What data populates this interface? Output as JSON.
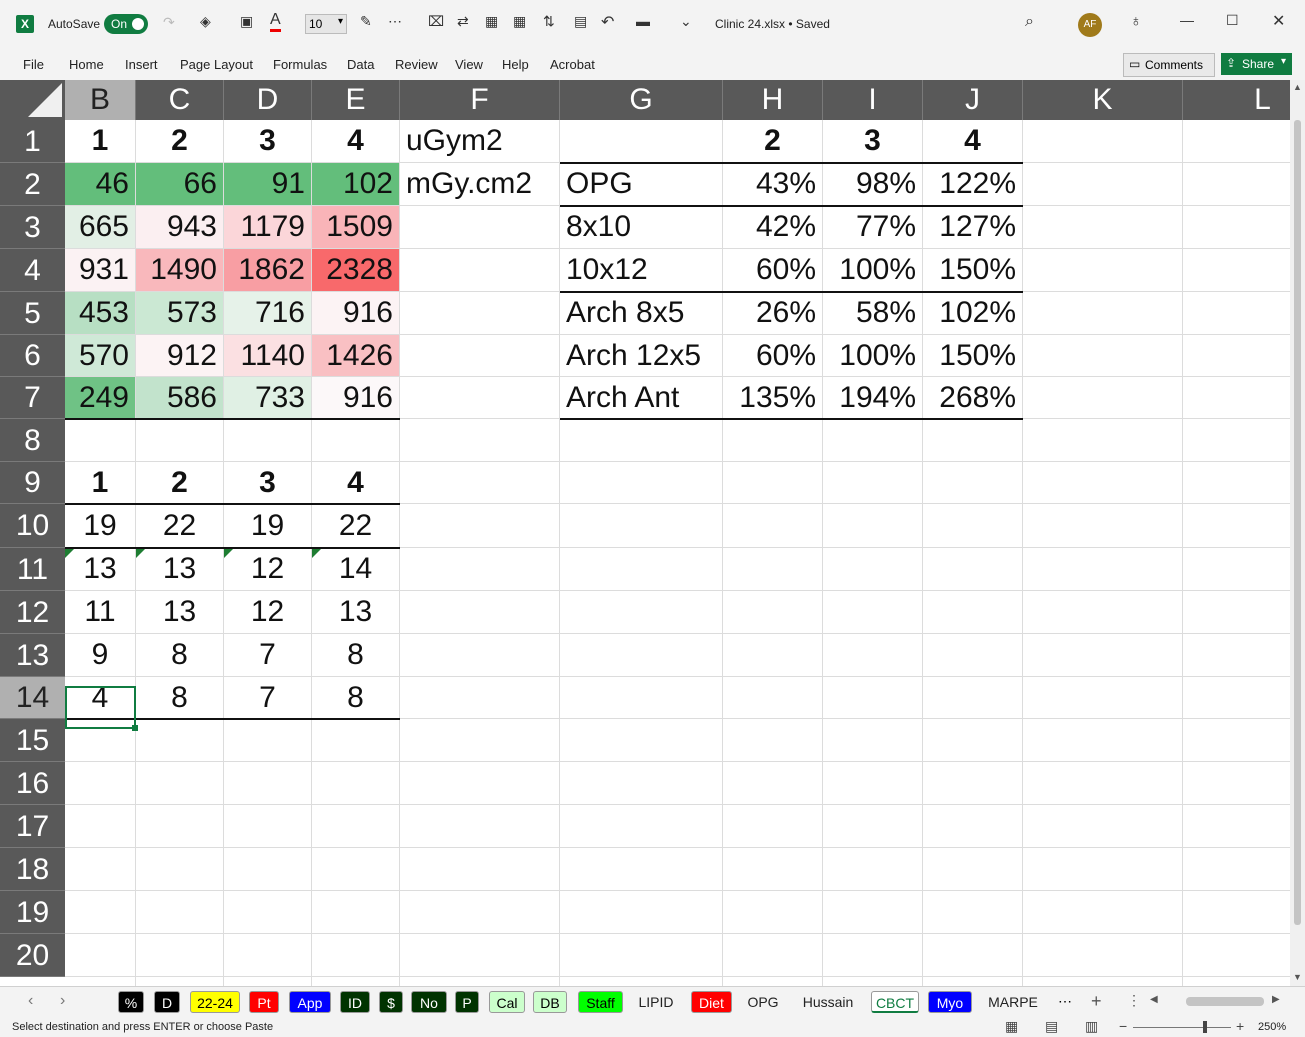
{
  "titlebar": {
    "autosave_label": "AutoSave",
    "autosave_state": "On",
    "font_size": "10",
    "file_title": "Clinic 24.xlsx • Saved",
    "user_initials": "AF"
  },
  "menu": [
    "File",
    "Home",
    "Insert",
    "Page Layout",
    "Formulas",
    "Data",
    "Review",
    "View",
    "Help",
    "Acrobat"
  ],
  "comments_label": "Comments",
  "share_label": "Share",
  "columns": [
    "B",
    "C",
    "D",
    "E",
    "F",
    "G",
    "H",
    "I",
    "J",
    "K",
    "L"
  ],
  "rows": [
    "1",
    "2",
    "3",
    "4",
    "5",
    "6",
    "7",
    "8",
    "9",
    "10",
    "11",
    "12",
    "13",
    "14",
    "15",
    "16",
    "17",
    "18",
    "19",
    "20"
  ],
  "table1": {
    "header": [
      "1",
      "2",
      "3",
      "4"
    ],
    "rows": [
      [
        "46",
        "66",
        "91",
        "102"
      ],
      [
        "665",
        "943",
        "1179",
        "1509"
      ],
      [
        "931",
        "1490",
        "1862",
        "2328"
      ],
      [
        "453",
        "573",
        "716",
        "916"
      ],
      [
        "570",
        "912",
        "1140",
        "1426"
      ],
      [
        "249",
        "586",
        "733",
        "916"
      ]
    ],
    "colors": [
      [
        "#63be7b",
        "#63be7b",
        "#63be7b",
        "#63be7b"
      ],
      [
        "#e2efe5",
        "#fbeff1",
        "#fbd6d9",
        "#f9b4b8"
      ],
      [
        "#fbf2f3",
        "#f9b8bc",
        "#f89ea3",
        "#f8696b"
      ],
      [
        "#b7dfc3",
        "#cbe8d3",
        "#e6f2e9",
        "#fcf3f4"
      ],
      [
        "#cfe9d7",
        "#fcf3f4",
        "#fbe0e2",
        "#f9c0c3"
      ],
      [
        "#6fc285",
        "#c2e3cc",
        "#e0f0e4",
        "#fcf8f9"
      ]
    ]
  },
  "unit_labels": [
    "uGym2",
    "mGy.cm2"
  ],
  "table2": {
    "header": [
      "2",
      "3",
      "4"
    ],
    "rows": [
      {
        "label": "OPG",
        "values": [
          "43%",
          "98%",
          "122%"
        ]
      },
      {
        "label": "8x10",
        "values": [
          "42%",
          "77%",
          "127%"
        ]
      },
      {
        "label": "10x12",
        "values": [
          "60%",
          "100%",
          "150%"
        ]
      },
      {
        "label": "Arch 8x5",
        "values": [
          "26%",
          "58%",
          "102%"
        ]
      },
      {
        "label": "Arch 12x5",
        "values": [
          "60%",
          "100%",
          "150%"
        ]
      },
      {
        "label": "Arch Ant",
        "values": [
          "135%",
          "194%",
          "268%"
        ]
      }
    ]
  },
  "table3": {
    "header": [
      "1",
      "2",
      "3",
      "4"
    ],
    "rows": [
      [
        "19",
        "22",
        "19",
        "22"
      ],
      [
        "13",
        "13",
        "12",
        "14"
      ],
      [
        "11",
        "13",
        "12",
        "13"
      ],
      [
        "9",
        "8",
        "7",
        "8"
      ],
      [
        "4",
        "8",
        "7",
        "8"
      ]
    ]
  },
  "sheet_tabs": [
    {
      "label": "%",
      "bg": "#000000",
      "fg": "#ffffff"
    },
    {
      "label": "D",
      "bg": "#000000",
      "fg": "#ffffff"
    },
    {
      "label": "22-24",
      "bg": "#ffff00",
      "fg": "#000000"
    },
    {
      "label": "Pt",
      "bg": "#ff0000",
      "fg": "#ffffff"
    },
    {
      "label": "App",
      "bg": "#0000ff",
      "fg": "#ffffff"
    },
    {
      "label": "ID",
      "bg": "#003300",
      "fg": "#ffffff"
    },
    {
      "label": "$",
      "bg": "#003300",
      "fg": "#ffffff"
    },
    {
      "label": "No",
      "bg": "#003300",
      "fg": "#ffffff"
    },
    {
      "label": "P",
      "bg": "#003300",
      "fg": "#ffffff"
    },
    {
      "label": "Cal",
      "bg": "#ccffcc",
      "fg": "#000000"
    },
    {
      "label": "DB",
      "bg": "#ccffcc",
      "fg": "#000000"
    },
    {
      "label": "Staff",
      "bg": "#00ff00",
      "fg": "#000000"
    },
    {
      "label": "LIPID",
      "bg": "",
      "fg": "#222222"
    },
    {
      "label": "Diet",
      "bg": "#ff0000",
      "fg": "#ffffff"
    },
    {
      "label": "OPG",
      "bg": "",
      "fg": "#222222"
    },
    {
      "label": "Hussain",
      "bg": "",
      "fg": "#222222"
    },
    {
      "label": "CBCT",
      "bg": "#ffffff",
      "fg": "#107c41"
    },
    {
      "label": "Myo",
      "bg": "#0000ff",
      "fg": "#ffffff"
    },
    {
      "label": "MARPE",
      "bg": "",
      "fg": "#222222"
    }
  ],
  "status_text": "Select destination and press ENTER or choose Paste",
  "zoom": "250%"
}
